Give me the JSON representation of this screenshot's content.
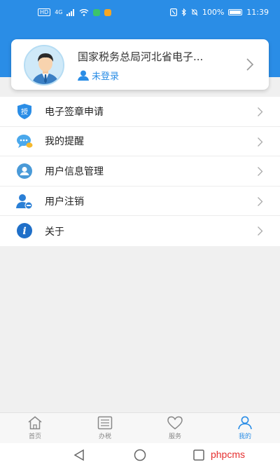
{
  "status_bar": {
    "hd": "HD",
    "network": "4G",
    "battery": "100%",
    "time": "11:39"
  },
  "profile": {
    "name": "国家税务总局河北省电子...",
    "login_status": "未登录"
  },
  "menu": {
    "items": [
      {
        "label": "电子签章申请",
        "icon": "shield-seal-icon",
        "icon_text": "授"
      },
      {
        "label": "我的提醒",
        "icon": "chat-bubble-icon"
      },
      {
        "label": "用户信息管理",
        "icon": "user-info-icon"
      },
      {
        "label": "用户注销",
        "icon": "user-remove-icon"
      },
      {
        "label": "关于",
        "icon": "info-icon",
        "icon_text": "i"
      }
    ]
  },
  "tabbar": {
    "tabs": [
      {
        "label": "首页",
        "icon": "home-icon"
      },
      {
        "label": "办税",
        "icon": "list-icon"
      },
      {
        "label": "服务",
        "icon": "heart-icon"
      },
      {
        "label": "我的",
        "icon": "person-icon",
        "active": true
      }
    ]
  },
  "watermark": "phpcms",
  "colors": {
    "primary": "#2a8de6",
    "background": "#f0f0f0",
    "watermark": "#e53030"
  }
}
